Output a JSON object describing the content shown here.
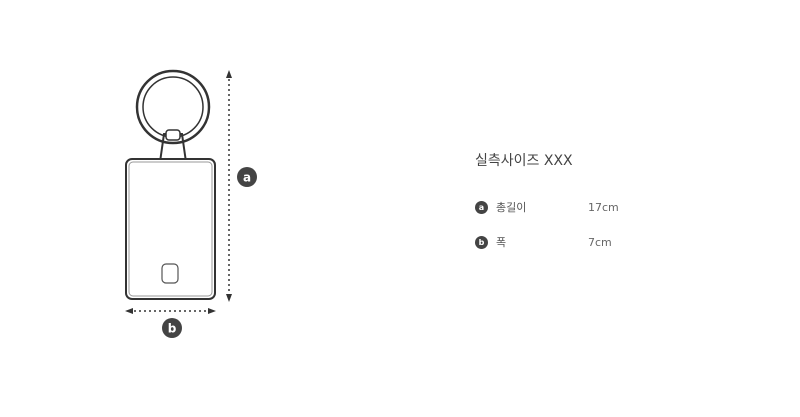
{
  "diagram": {
    "height_marker": "a",
    "width_marker": "b"
  },
  "size_info": {
    "title": "실측사이즈 XXX",
    "rows": [
      {
        "badge": "a",
        "label": "총길이",
        "value": "17cm"
      },
      {
        "badge": "b",
        "label": "폭",
        "value": "7cm"
      }
    ]
  },
  "colors": {
    "badge_fill": "#444444",
    "outline": "#333333"
  }
}
